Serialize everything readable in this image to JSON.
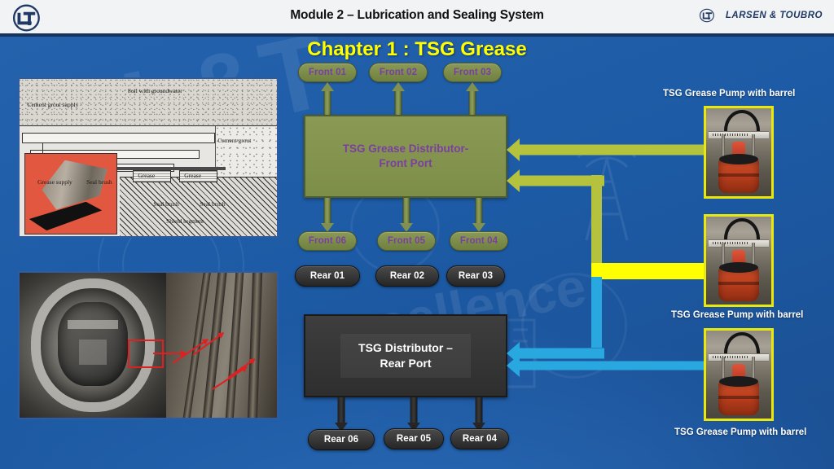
{
  "header": {
    "title": "Module 2 – Lubrication and Sealing System",
    "logo_left": "lt-logo-icon",
    "logo_right_icon": "lt-logo-icon",
    "logo_right_text": "LARSEN & TOUBRO"
  },
  "slide": {
    "chapter_title": "Chapter 1 : TSG Grease",
    "background_color": "#1d5ba6",
    "watermark_1": "L&T",
    "watermark_2": "Excellence"
  },
  "left_panel": {
    "seal_diagram": {
      "name": "tail-seal-cross-section-diagram",
      "labels": [
        "Soil with groundwater",
        "Cement grout supply",
        "Cement grout",
        "Grease supply",
        "Seal brush",
        "Grease",
        "Grease",
        "Seal brush",
        "Seal brush",
        "Shield segment"
      ]
    },
    "tunnel_photos": {
      "name": "tbm-tunnel-photos",
      "caption": ""
    }
  },
  "flow": {
    "front_top_ports": [
      {
        "label": "Front 01"
      },
      {
        "label": "Front 02"
      },
      {
        "label": "Front 03"
      }
    ],
    "front_distributor": {
      "line1": "TSG Grease Distributor-",
      "line2": "Front Port",
      "color": "#7d8e49",
      "text_color": "#7a3fa0"
    },
    "front_bottom_ports": [
      {
        "label": "Front 06"
      },
      {
        "label": "Front 05"
      },
      {
        "label": "Front 04"
      }
    ],
    "rear_top_ports": [
      {
        "label": "Rear 01"
      },
      {
        "label": "Rear 02"
      },
      {
        "label": "Rear 03"
      }
    ],
    "rear_distributor": {
      "line1": "TSG Distributor –",
      "line2": "Rear Port",
      "color": "#2e2e2e",
      "text_color": "#ffffff"
    },
    "rear_bottom_ports": [
      {
        "label": "Rear 06"
      },
      {
        "label": "Rear 05"
      },
      {
        "label": "Rear 04"
      }
    ],
    "arrow_colors": {
      "front_feed": "#b5c23e",
      "mid_feed": "#ffff00",
      "rear_feed": "#29a8e0",
      "port_connector_front": "#7f9050",
      "port_connector_rear": "#262626"
    }
  },
  "right_panel": {
    "pumps": [
      {
        "label": "TSG Grease Pump with barrel",
        "label_position": "above"
      },
      {
        "label": "TSG Grease Pump with barrel",
        "label_position": "below"
      },
      {
        "label": "TSG Grease Pump with barrel",
        "label_position": "below"
      }
    ],
    "photo_border_color": "#e8e80d"
  }
}
